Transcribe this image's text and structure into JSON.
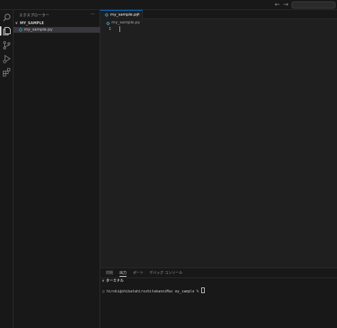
{
  "titlebar": {
    "back_icon": "arrow-left-icon",
    "forward_icon": "arrow-right-icon",
    "back_glyph": "←",
    "forward_glyph": "→"
  },
  "activity_bar": {
    "items": [
      "search-icon",
      "files-icon",
      "source-control-icon",
      "run-debug-icon",
      "extensions-icon"
    ]
  },
  "sidebar": {
    "title": "エクスプローラー",
    "more_label": "···",
    "folder": {
      "chevron": "∨",
      "label": "MY_SAMPLE"
    },
    "files": [
      {
        "label": "my_sample.py",
        "icon": "python-file-icon"
      }
    ]
  },
  "editor": {
    "tab": {
      "label": "my_sample.py",
      "close_label": "✕"
    },
    "breadcrumb": {
      "label": "my_sample.py"
    },
    "line_numbers": [
      "1"
    ]
  },
  "panel": {
    "tabs": [
      {
        "label": "問題",
        "active": false
      },
      {
        "label": "出力",
        "active": true
      },
      {
        "label": "ポート",
        "active": false
      },
      {
        "label": "デバッグ コンソール",
        "active": false
      }
    ],
    "terminal": {
      "chevron": "∨",
      "label": "ターミナル",
      "prompt": "○ hiroki@shibatahiroshitakanoiMac my_sample % "
    }
  },
  "colors": {
    "accent": "#0078d4",
    "python_icon": "#519aba",
    "background": "#1f1f1f",
    "sidebar_bg": "#181818"
  }
}
